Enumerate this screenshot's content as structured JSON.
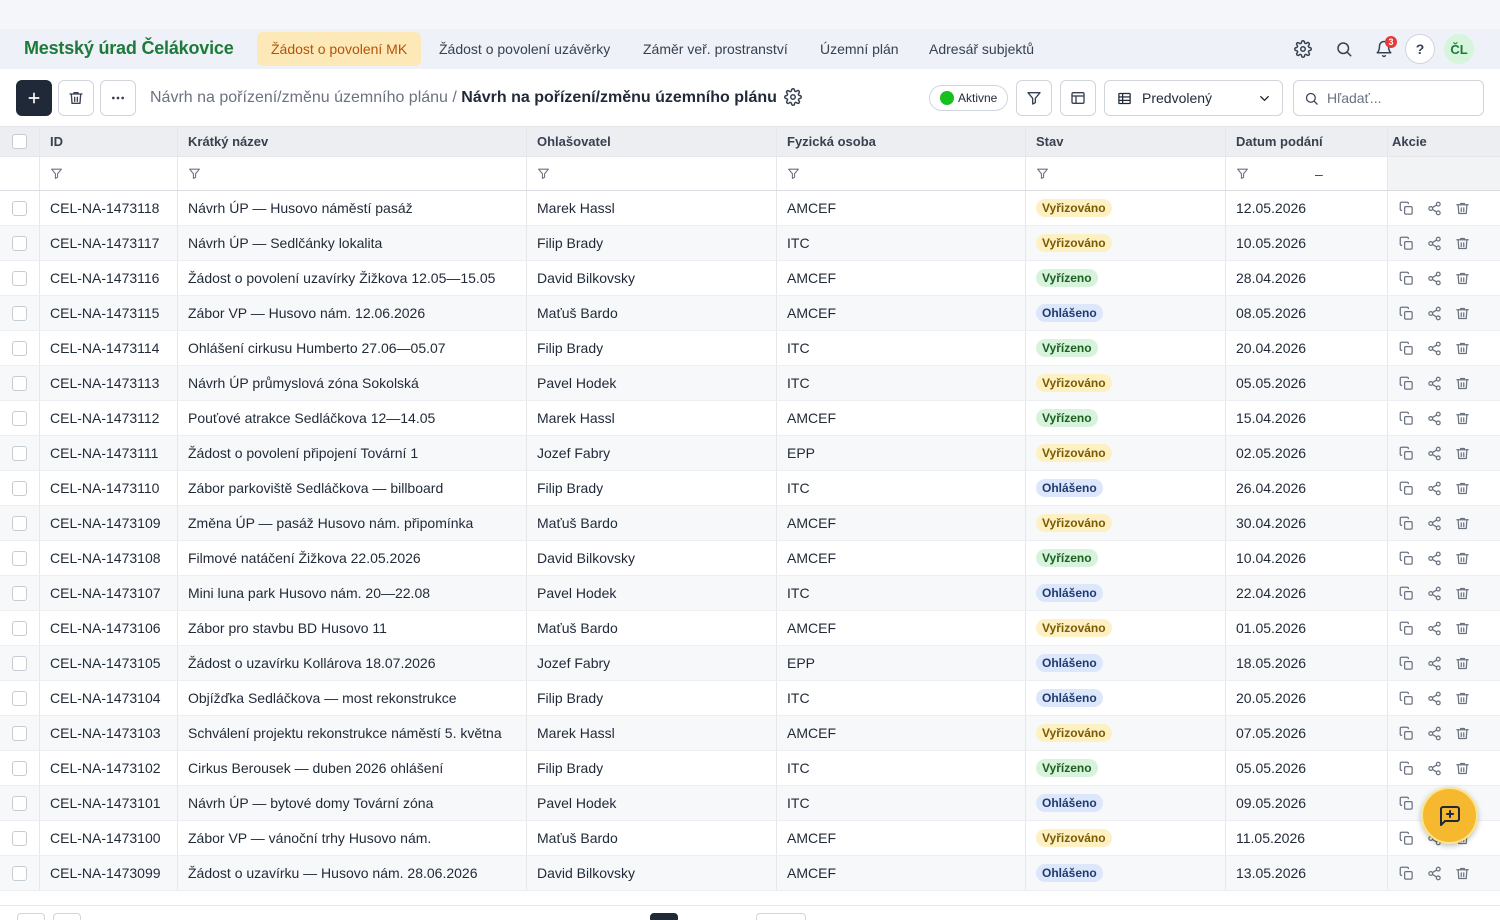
{
  "app": {
    "title": "Mestský úrad Čelákovice"
  },
  "nav": {
    "tabs": [
      {
        "label": "Žádost o povolení MK",
        "active": true
      },
      {
        "label": "Žádost o povolení uzávěrky",
        "active": false
      },
      {
        "label": "Záměr veř. prostranství",
        "active": false
      },
      {
        "label": "Územní plán",
        "active": false
      },
      {
        "label": "Adresář subjektů",
        "active": false
      }
    ],
    "icons": [
      "gear-icon",
      "search-icon",
      "bell-icon",
      "help-icon"
    ],
    "notification_count": "3",
    "help_label": "?",
    "avatar_initials": "ČL"
  },
  "toolbar": {
    "breadcrumb_parent": "Návrh na pořízení/změnu územního plánu /",
    "breadcrumb_current": "Návrh na pořízení/změnu územního plánu",
    "status_label": "Aktivne",
    "view_select_value": "Predvolený",
    "search_placeholder": "Hľadať..."
  },
  "table": {
    "columns": [
      "ID",
      "Krátký název",
      "Ohlašovatel",
      "Fyzická osoba",
      "Stav",
      "Datum podání",
      "Akcie"
    ],
    "filter_date_separator": "–",
    "rows": [
      {
        "id": "CEL-NA-1473118",
        "name": "Návrh ÚP — Husovo náměstí pasáž",
        "ohl": "Marek Hassl",
        "fyz": "AMCEF",
        "stav": "Vyřizováno",
        "datum": "12.05.2026"
      },
      {
        "id": "CEL-NA-1473117",
        "name": "Návrh ÚP — Sedlčánky lokalita",
        "ohl": "Filip Brady",
        "fyz": "ITC",
        "stav": "Vyřizováno",
        "datum": "10.05.2026"
      },
      {
        "id": "CEL-NA-1473116",
        "name": "Žádost o povolení uzavírky Žižkova 12.05—15.05",
        "ohl": "David Bilkovsky",
        "fyz": "AMCEF",
        "stav": "Vyřízeno",
        "datum": "28.04.2026"
      },
      {
        "id": "CEL-NA-1473115",
        "name": "Zábor VP — Husovo nám. 12.06.2026",
        "ohl": "Maťuš Bardo",
        "fyz": "AMCEF",
        "stav": "Ohlášeno",
        "datum": "08.05.2026"
      },
      {
        "id": "CEL-NA-1473114",
        "name": "Ohlášení cirkusu Humberto 27.06—05.07",
        "ohl": "Filip Brady",
        "fyz": "ITC",
        "stav": "Vyřízeno",
        "datum": "20.04.2026"
      },
      {
        "id": "CEL-NA-1473113",
        "name": "Návrh ÚP průmyslová zóna Sokolská",
        "ohl": "Pavel Hodek",
        "fyz": "ITC",
        "stav": "Vyřizováno",
        "datum": "05.05.2026"
      },
      {
        "id": "CEL-NA-1473112",
        "name": "Pouťové atrakce Sedláčkova 12—14.05",
        "ohl": "Marek Hassl",
        "fyz": "AMCEF",
        "stav": "Vyřízeno",
        "datum": "15.04.2026"
      },
      {
        "id": "CEL-NA-1473111",
        "name": "Žádost o povolení připojení Tovární 1",
        "ohl": "Jozef Fabry",
        "fyz": "EPP",
        "stav": "Vyřizováno",
        "datum": "02.05.2026"
      },
      {
        "id": "CEL-NA-1473110",
        "name": "Zábor parkoviště Sedláčkova — billboard",
        "ohl": "Filip Brady",
        "fyz": "ITC",
        "stav": "Ohlášeno",
        "datum": "26.04.2026"
      },
      {
        "id": "CEL-NA-1473109",
        "name": "Změna ÚP — pasáž Husovo nám. připomínka",
        "ohl": "Maťuš Bardo",
        "fyz": "AMCEF",
        "stav": "Vyřizováno",
        "datum": "30.04.2026"
      },
      {
        "id": "CEL-NA-1473108",
        "name": "Filmové natáčení Žižkova 22.05.2026",
        "ohl": "David Bilkovsky",
        "fyz": "AMCEF",
        "stav": "Vyřízeno",
        "datum": "10.04.2026"
      },
      {
        "id": "CEL-NA-1473107",
        "name": "Mini luna park Husovo nám. 20—22.08",
        "ohl": "Pavel Hodek",
        "fyz": "ITC",
        "stav": "Ohlášeno",
        "datum": "22.04.2026"
      },
      {
        "id": "CEL-NA-1473106",
        "name": "Zábor pro stavbu BD Husovo 11",
        "ohl": "Maťuš Bardo",
        "fyz": "AMCEF",
        "stav": "Vyřizováno",
        "datum": "01.05.2026"
      },
      {
        "id": "CEL-NA-1473105",
        "name": "Žádost o uzavírku Kollárova 18.07.2026",
        "ohl": "Jozef Fabry",
        "fyz": "EPP",
        "stav": "Ohlášeno",
        "datum": "18.05.2026"
      },
      {
        "id": "CEL-NA-1473104",
        "name": "Objížďka Sedláčkova — most rekonstrukce",
        "ohl": "Filip Brady",
        "fyz": "ITC",
        "stav": "Ohlášeno",
        "datum": "20.05.2026"
      },
      {
        "id": "CEL-NA-1473103",
        "name": "Schválení projektu rekonstrukce náměstí 5. května",
        "ohl": "Marek Hassl",
        "fyz": "AMCEF",
        "stav": "Vyřizováno",
        "datum": "07.05.2026"
      },
      {
        "id": "CEL-NA-1473102",
        "name": "Cirkus Berousek — duben 2026 ohlášení",
        "ohl": "Filip Brady",
        "fyz": "ITC",
        "stav": "Vyřízeno",
        "datum": "05.05.2026"
      },
      {
        "id": "CEL-NA-1473101",
        "name": "Návrh ÚP — bytové domy Tovární zóna",
        "ohl": "Pavel Hodek",
        "fyz": "ITC",
        "stav": "Ohlášeno",
        "datum": "09.05.2026"
      },
      {
        "id": "CEL-NA-1473100",
        "name": "Zábor VP — vánoční trhy Husovo nám.",
        "ohl": "Maťuš Bardo",
        "fyz": "AMCEF",
        "stav": "Vyřizováno",
        "datum": "11.05.2026"
      },
      {
        "id": "CEL-NA-1473099",
        "name": "Žádost o uzavírku — Husovo nám. 28.06.2026",
        "ohl": "David Bilkovsky",
        "fyz": "AMCEF",
        "stav": "Ohlášeno",
        "datum": "13.05.2026"
      }
    ]
  },
  "status_colors": {
    "Vyřizováno": "#fdf1c4",
    "Vyřízeno": "#d7f3dc",
    "Ohlášeno": "#dde7fb"
  },
  "colors": {
    "brand": "#1d7a3a",
    "active_tab_bg": "#fde9b8",
    "fab": "#f5b82e"
  }
}
